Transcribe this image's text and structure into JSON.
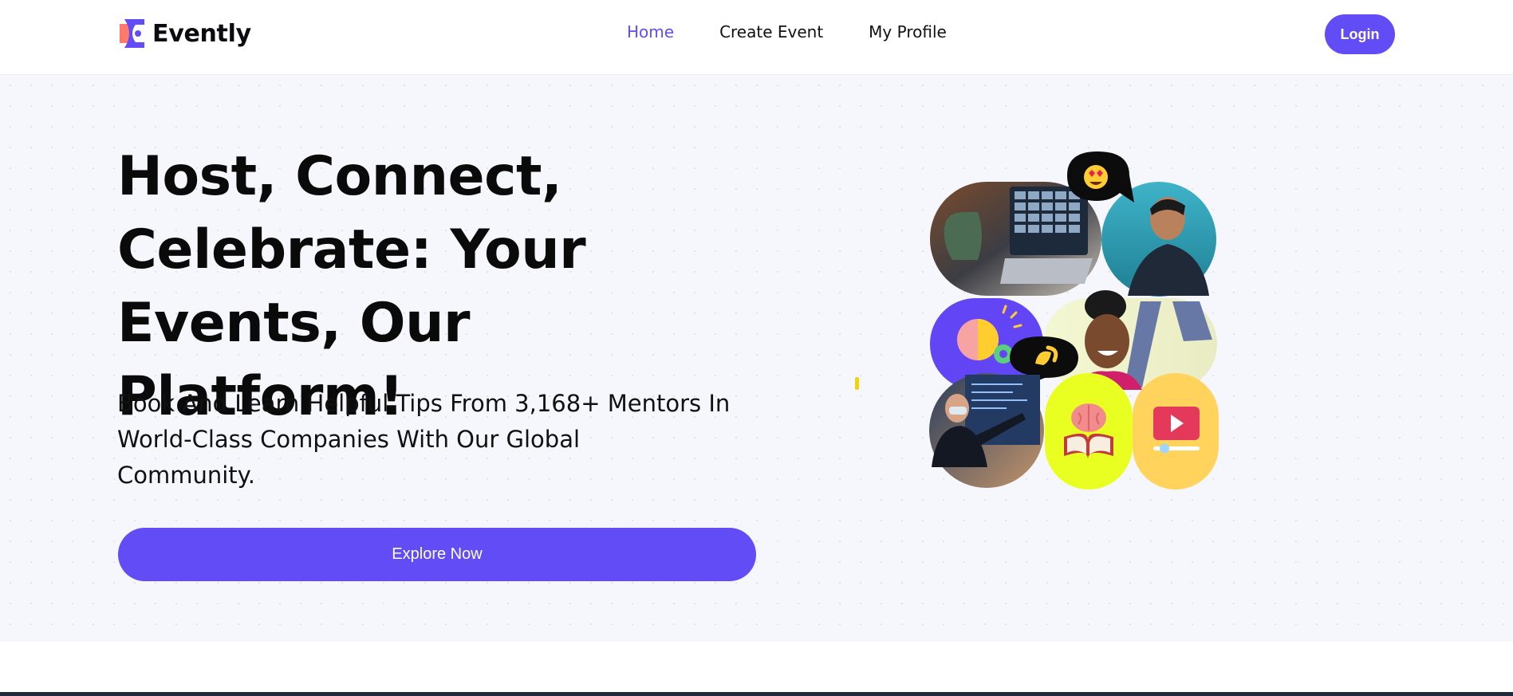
{
  "brand": {
    "name": "Evently",
    "logo_icon": "evently-logo-icon",
    "accent": "#624cf5",
    "logo_colors": [
      "#ff7a6b",
      "#624cf5"
    ]
  },
  "nav": {
    "items": [
      {
        "label": "Home",
        "active": true
      },
      {
        "label": "Create Event",
        "active": false
      },
      {
        "label": "My Profile",
        "active": false
      }
    ]
  },
  "header": {
    "login_label": "Login"
  },
  "hero": {
    "title_lines": [
      "Host, Connect,",
      "Celebrate: Your",
      "Events, Our Platform!"
    ],
    "subtitle_lines": [
      "Book And Learn Helpful Tips From 3,168+ Mentors In",
      "World-Class Companies With Our Global",
      "Community."
    ],
    "cta_label": "Explore Now",
    "collage": {
      "tiles": [
        "laptop-video-call-photo",
        "smiling-man-photo",
        "brain-idea-icon",
        "smiling-woman-photo",
        "presenter-screen-photo",
        "brain-book-icon",
        "video-play-icon"
      ],
      "bubbles": [
        "heart-eyes-emoji",
        "pinching-hand-emoji"
      ],
      "colors": {
        "purple": "#6246f5",
        "lime": "#e9ff21",
        "yellow": "#ffd35c",
        "bubble": "#0c0c0c"
      }
    }
  }
}
